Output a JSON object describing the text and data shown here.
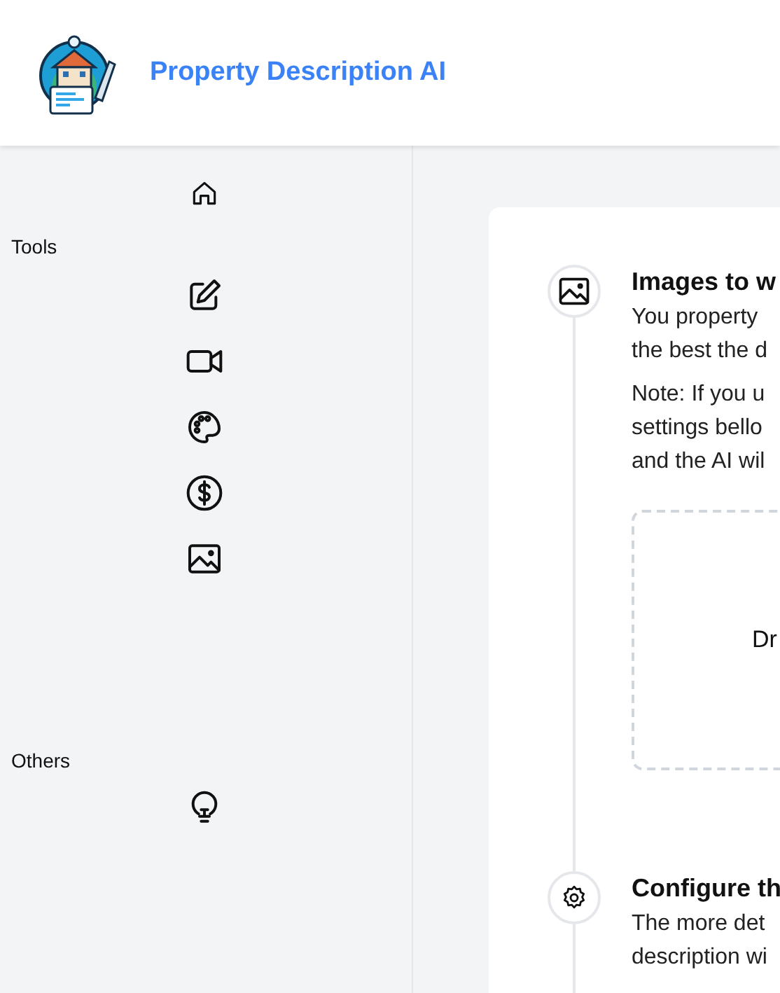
{
  "header": {
    "title": "Property Description AI"
  },
  "sidebar": {
    "home": {
      "kind": "home"
    },
    "sections": [
      {
        "title": "Tools",
        "items": [
          {
            "kind": "pencil"
          },
          {
            "kind": "video"
          },
          {
            "kind": "palette"
          },
          {
            "kind": "dollar"
          },
          {
            "kind": "image"
          }
        ]
      },
      {
        "title": "Others",
        "items": [
          {
            "kind": "bulb"
          }
        ]
      }
    ]
  },
  "steps": [
    {
      "kind": "image",
      "title": "Images to w",
      "paragraphs": [
        [
          "You property",
          "the best the d"
        ],
        [
          "Note: If you u",
          "settings bello",
          "and the AI wil"
        ]
      ],
      "dropzone": {
        "text": "Dr"
      }
    },
    {
      "kind": "gear",
      "title": "Configure th",
      "paragraphs": [
        [
          "The more det",
          "description wi"
        ]
      ]
    }
  ]
}
